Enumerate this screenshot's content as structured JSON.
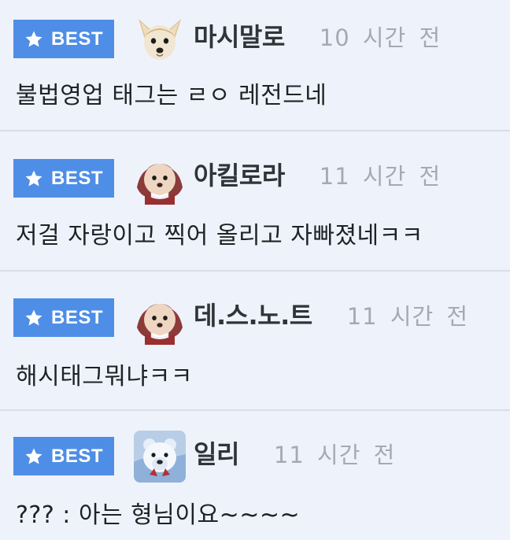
{
  "badge_label": "BEST",
  "colors": {
    "background": "#eef3fb",
    "badge": "#4f8ee6",
    "divider": "#d9dde7",
    "username": "#303338",
    "timestamp": "#a4aab4",
    "comment_text": "#1f2226"
  },
  "comments": [
    {
      "badge": "BEST",
      "avatar": "chihuahua-avatar",
      "username": "마시말로",
      "time": "10 시간 전",
      "text": "불법영업 태그는 ㄹㅇ 레전드네"
    },
    {
      "badge": "BEST",
      "avatar": "puppy-avatar",
      "username": "아킬로라",
      "time": "11 시간 전",
      "text": "저걸 자랑이고 찍어 올리고 자빠졌네ㅋㅋ"
    },
    {
      "badge": "BEST",
      "avatar": "puppy-avatar",
      "username": "데.스.노.트",
      "time": "11 시간 전",
      "text": "해시태그뭐냐ㅋㅋ"
    },
    {
      "badge": "BEST",
      "avatar": "polar-bear-avatar",
      "username": "일리",
      "time": "11 시간 전",
      "text": "??? : 아는 형님이요~~~~"
    }
  ]
}
